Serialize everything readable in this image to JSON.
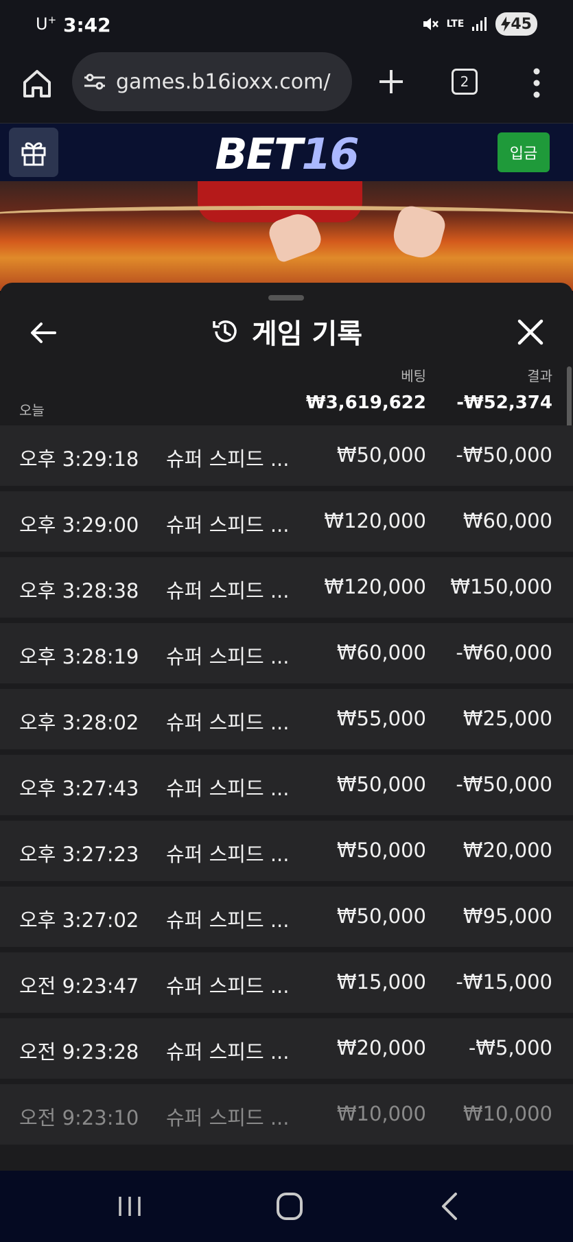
{
  "status_bar": {
    "carrier": "U",
    "carrier_sup": "+",
    "time": "3:42",
    "network": "LTE",
    "battery": "45"
  },
  "browser": {
    "url": "games.b16ioxx.com/",
    "tab_count": "2"
  },
  "site": {
    "logo_part1": "BET",
    "logo_part2": "16",
    "deposit_label": "입금"
  },
  "sheet": {
    "title": "게임 기록",
    "columns": {
      "bet": "베팅",
      "result": "결과"
    },
    "summary": {
      "label": "오늘",
      "bet_total": "₩3,619,622",
      "result_total": "-₩52,374"
    },
    "rows": [
      {
        "time": "오후 3:29:18",
        "game": "슈퍼 스피드 ...",
        "bet": "₩50,000",
        "result": "-₩50,000"
      },
      {
        "time": "오후 3:29:00",
        "game": "슈퍼 스피드 ...",
        "bet": "₩120,000",
        "result": "₩60,000"
      },
      {
        "time": "오후 3:28:38",
        "game": "슈퍼 스피드 ...",
        "bet": "₩120,000",
        "result": "₩150,000"
      },
      {
        "time": "오후 3:28:19",
        "game": "슈퍼 스피드 ...",
        "bet": "₩60,000",
        "result": "-₩60,000"
      },
      {
        "time": "오후 3:28:02",
        "game": "슈퍼 스피드 ...",
        "bet": "₩55,000",
        "result": "₩25,000"
      },
      {
        "time": "오후 3:27:43",
        "game": "슈퍼 스피드 ...",
        "bet": "₩50,000",
        "result": "-₩50,000"
      },
      {
        "time": "오후 3:27:23",
        "game": "슈퍼 스피드 ...",
        "bet": "₩50,000",
        "result": "₩20,000"
      },
      {
        "time": "오후 3:27:02",
        "game": "슈퍼 스피드 ...",
        "bet": "₩50,000",
        "result": "₩95,000"
      },
      {
        "time": "오전 9:23:47",
        "game": "슈퍼 스피드 ...",
        "bet": "₩15,000",
        "result": "-₩15,000"
      },
      {
        "time": "오전 9:23:28",
        "game": "슈퍼 스피드 ...",
        "bet": "₩20,000",
        "result": "-₩5,000"
      },
      {
        "time": "오전 9:23:10",
        "game": "슈퍼 스피드 ...",
        "bet": "₩10,000",
        "result": "₩10,000"
      }
    ]
  },
  "icons": {
    "home": "home-icon",
    "site_info": "tune-icon",
    "new_tab": "plus-icon",
    "menu": "more-vertical-icon",
    "gift": "gift-icon",
    "back": "arrow-left-icon",
    "history": "history-icon",
    "close": "close-icon",
    "mute": "mute-icon",
    "signal": "signal-icon"
  },
  "colors": {
    "deposit": "#1f9a3a",
    "logo_accent": "#aab8ff",
    "sheet_bg": "#1c1c1e",
    "row_bg": "#262628"
  }
}
